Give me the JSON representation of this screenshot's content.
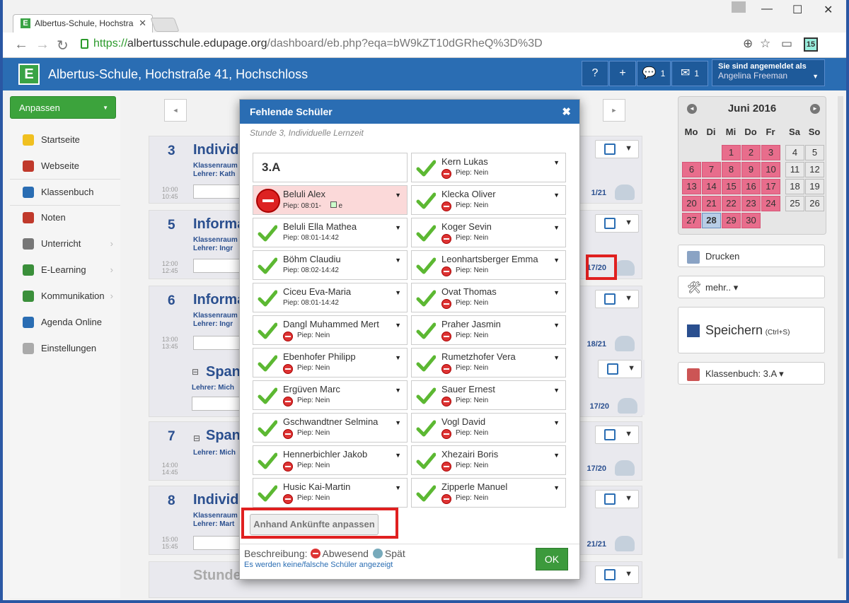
{
  "browser": {
    "tab_title": "Albertus-Schule, Hochstra",
    "url_https": "https://",
    "url_host": "albertusschule.edupage.org",
    "url_path": "/dashboard/eb.php?eqa=bW9kZT10dGRheQ%3D%3D",
    "ext_badge": "15"
  },
  "app": {
    "logo_letter": "E",
    "title": "Albertus-Schule, Hochstraße 41, Hochschloss",
    "help": "?",
    "plus": "+",
    "messages_count": "1",
    "mail_count": "1",
    "user_label": "Sie sind angemeldet als",
    "user_name": "Angelina Freeman"
  },
  "sidebar": {
    "anpassen": "Anpassen",
    "items": [
      {
        "label": "Startseite",
        "color": "#f0c020"
      },
      {
        "label": "Webseite",
        "color": "#c0392b"
      },
      {
        "label": "Klassenbuch",
        "color": "#2a6db3"
      },
      {
        "label": "Noten",
        "color": "#c0392b"
      },
      {
        "label": "Unterricht",
        "color": "#777777"
      },
      {
        "label": "E-Learning",
        "color": "#3a8f3a"
      },
      {
        "label": "Kommunikation",
        "color": "#3a8f3a"
      },
      {
        "label": "Agenda Online",
        "color": "#2a6db3"
      },
      {
        "label": "Einstellungen",
        "color": "#aaaaaa"
      }
    ]
  },
  "lessons": [
    {
      "num": "3",
      "name": "Individu",
      "meta1": "Klassenraum",
      "meta2": "Lehrer:  Kath",
      "t1": "10:00",
      "t2": "10:45",
      "count": "1/21"
    },
    {
      "num": "5",
      "name": "Informa",
      "meta1": "Klassenraum",
      "meta2": "Lehrer:  Ingr",
      "t1": "12:00",
      "t2": "12:45",
      "count": "17/20"
    },
    {
      "num": "6",
      "name": "Informa",
      "meta1": "Klassenraum",
      "meta2": "Lehrer:  Ingr",
      "t1": "13:00",
      "t2": "13:45",
      "count": "18/21"
    },
    {
      "num": "",
      "name": "Span",
      "meta1": "Lehrer:  Mich",
      "count": "17/20"
    },
    {
      "num": "7",
      "name": "Span",
      "meta1": "Lehrer:  Mich",
      "t1": "14:00",
      "t2": "14:45",
      "count": "17/20"
    },
    {
      "num": "8",
      "name": "Individu",
      "meta1": "Klassenraum",
      "meta2": "Lehrer:  Mart",
      "t1": "15:00",
      "t2": "15:45",
      "count": "21/21"
    },
    {
      "name": "Stunde"
    }
  ],
  "calendar": {
    "month": "Juni 2016",
    "weekdays": [
      "Mo",
      "Di",
      "Mi",
      "Do",
      "Fr",
      "Sa",
      "So"
    ],
    "weeks": [
      [
        "",
        "",
        "1",
        "2",
        "3",
        "4",
        "5"
      ],
      [
        "6",
        "7",
        "8",
        "9",
        "10",
        "11",
        "12"
      ],
      [
        "13",
        "14",
        "15",
        "16",
        "17",
        "18",
        "19"
      ],
      [
        "20",
        "21",
        "22",
        "23",
        "24",
        "25",
        "26"
      ],
      [
        "27",
        "28",
        "29",
        "30",
        "",
        "",
        ""
      ]
    ]
  },
  "right": {
    "drucken": "Drucken",
    "mehr": "mehr.. ▾",
    "speichern": "Speichern",
    "speichern_hint": "(Ctrl+S)",
    "klassenbuch": "Klassenbuch: 3.A ▾"
  },
  "modal": {
    "title": "Fehlende Schüler",
    "subtitle": "Stunde 3, Individuelle Lernzeit",
    "class": "3.A",
    "students": [
      {
        "name": "Kern Lukas",
        "status": "Piep: Nein",
        "absent": false
      },
      {
        "name": "Beluli Alex",
        "status": "Piep: 08:01-",
        "extra": "e",
        "absent": true
      },
      {
        "name": "Klecka Oliver",
        "status": "Piep: Nein",
        "absent": false
      },
      {
        "name": "Beluli Ella Mathea",
        "status": "Piep: 08:01-14:42",
        "absent": false,
        "plain": true
      },
      {
        "name": "Koger Sevin",
        "status": "Piep: Nein",
        "absent": false
      },
      {
        "name": "Böhm Claudiu",
        "status": "Piep: 08:02-14:42",
        "absent": false,
        "plain": true
      },
      {
        "name": "Leonhartsberger Emma",
        "status": "Piep: Nein",
        "absent": false
      },
      {
        "name": "Ciceu Eva-Maria",
        "status": "Piep: 08:01-14:42",
        "absent": false,
        "plain": true
      },
      {
        "name": "Ovat Thomas",
        "status": "Piep: Nein",
        "absent": false
      },
      {
        "name": "Dangl Muhammed Mert",
        "status": "Piep: Nein",
        "absent": false
      },
      {
        "name": "Praher Jasmin",
        "status": "Piep: Nein",
        "absent": false
      },
      {
        "name": "Ebenhofer Philipp",
        "status": "Piep: Nein",
        "absent": false
      },
      {
        "name": "Rumetzhofer Vera",
        "status": "Piep: Nein",
        "absent": false
      },
      {
        "name": "Ergüven Marc",
        "status": "Piep: Nein",
        "absent": false
      },
      {
        "name": "Sauer Ernest",
        "status": "Piep: Nein",
        "absent": false
      },
      {
        "name": "Gschwandtner Selmina",
        "status": "Piep: Nein",
        "absent": false
      },
      {
        "name": "Vogl David",
        "status": "Piep: Nein",
        "absent": false
      },
      {
        "name": "Hennerbichler Jakob",
        "status": "Piep: Nein",
        "absent": false
      },
      {
        "name": "Xhezairi Boris",
        "status": "Piep: Nein",
        "absent": false
      },
      {
        "name": "Husic Kai-Martin",
        "status": "Piep: Nein",
        "absent": false
      },
      {
        "name": "Zipperle Manuel",
        "status": "Piep: Nein",
        "absent": false
      }
    ],
    "adjust_button": "Anhand Ankünfte anpassen",
    "legend_label": "Beschreibung:",
    "legend_absent": "Abwesend",
    "legend_late": "Spät",
    "wrong_link": "Es werden keine/falsche Schüler angezeigt",
    "ok": "OK"
  }
}
